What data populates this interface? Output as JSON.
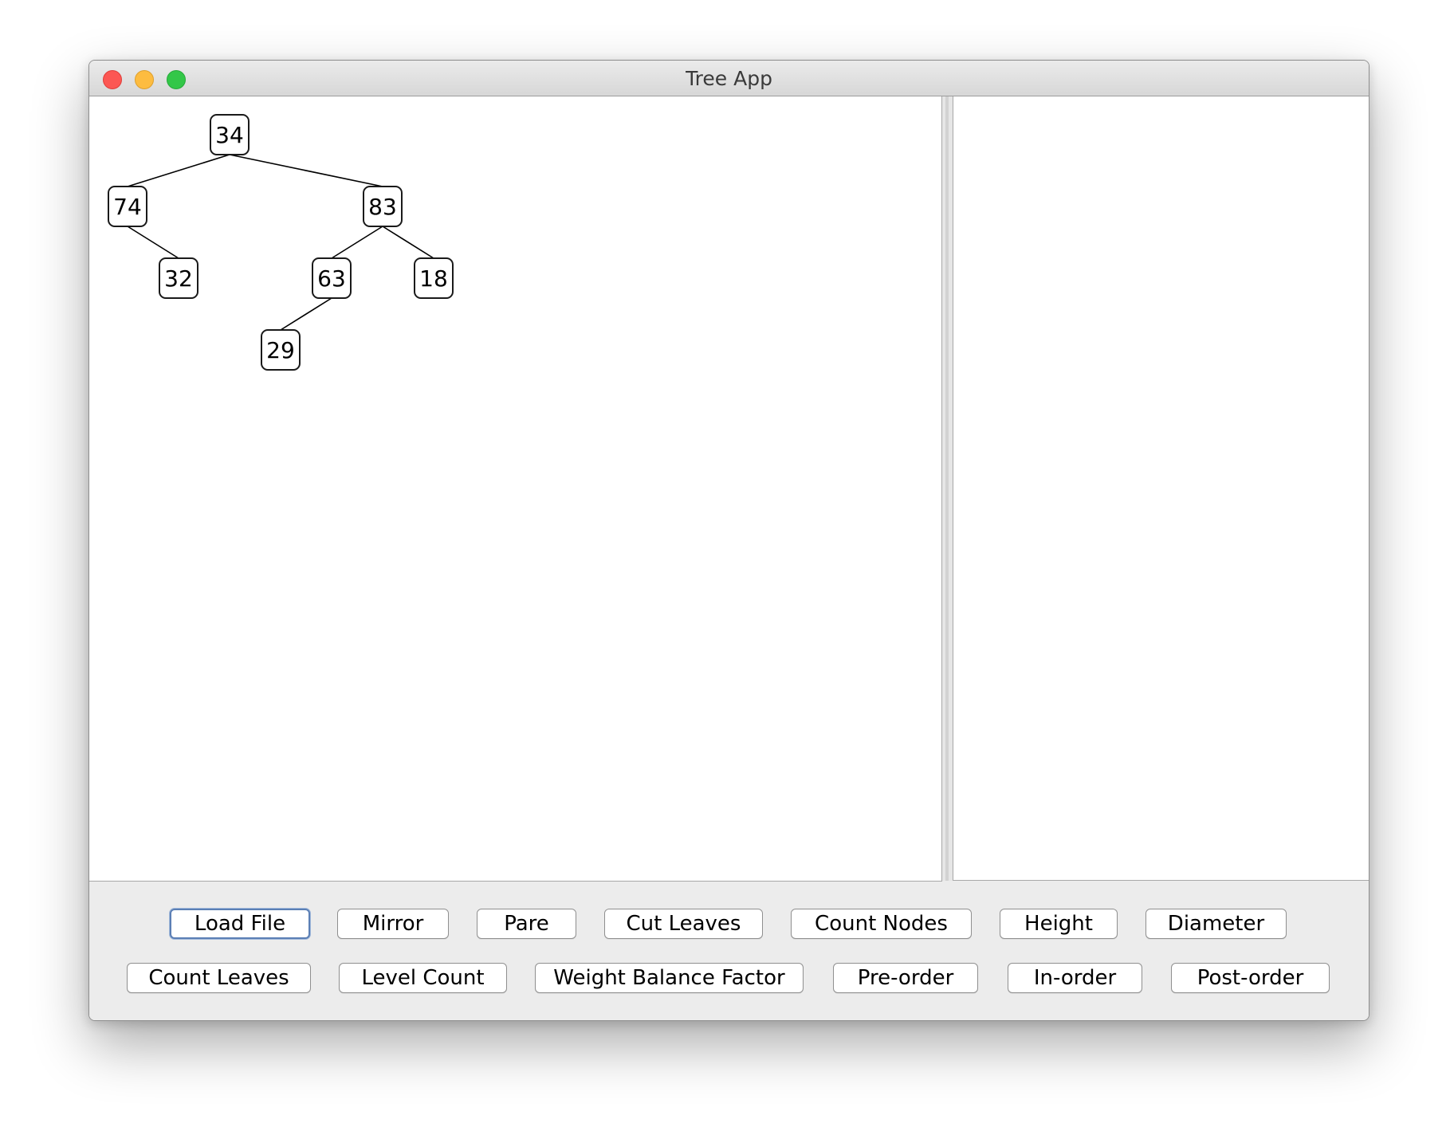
{
  "window": {
    "title": "Tree App",
    "controls": [
      "close",
      "minimize",
      "maximize"
    ]
  },
  "tree": {
    "nodes": [
      {
        "id": "n34",
        "label": "34",
        "depth": 0,
        "slot": 2
      },
      {
        "id": "n74",
        "label": "74",
        "depth": 1,
        "slot": 0
      },
      {
        "id": "n83",
        "label": "83",
        "depth": 1,
        "slot": 5
      },
      {
        "id": "n32",
        "label": "32",
        "depth": 2,
        "slot": 1
      },
      {
        "id": "n63",
        "label": "63",
        "depth": 2,
        "slot": 4
      },
      {
        "id": "n18",
        "label": "18",
        "depth": 2,
        "slot": 6
      },
      {
        "id": "n29",
        "label": "29",
        "depth": 3,
        "slot": 3
      }
    ],
    "edges": [
      [
        "n34",
        "n74"
      ],
      [
        "n34",
        "n83"
      ],
      [
        "n74",
        "n32"
      ],
      [
        "n83",
        "n63"
      ],
      [
        "n83",
        "n18"
      ],
      [
        "n63",
        "n29"
      ]
    ]
  },
  "buttons": {
    "row1": [
      "Load File",
      "Mirror",
      "Pare",
      "Cut Leaves",
      "Count Nodes",
      "Height",
      "Diameter"
    ],
    "row2": [
      "Count Leaves",
      "Level Count",
      "Weight Balance Factor",
      "Pre-order",
      "In-order",
      "Post-order"
    ],
    "focused": "Load File"
  },
  "output": {
    "text": ""
  }
}
